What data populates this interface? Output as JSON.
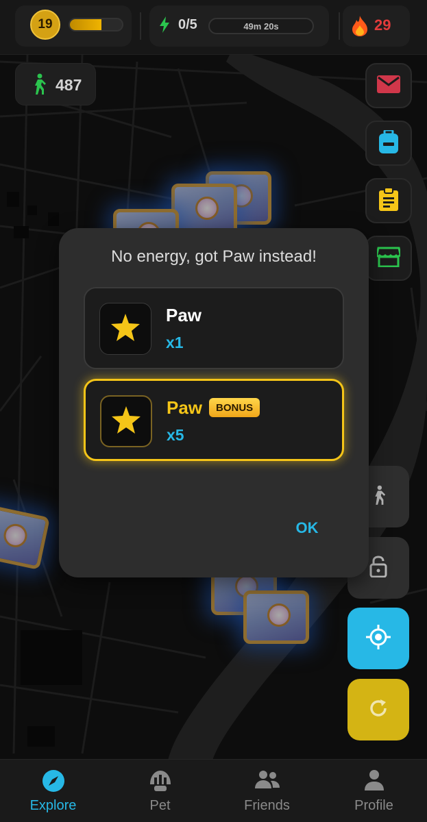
{
  "hud": {
    "level": "19",
    "xp_progress": 0.6,
    "energy": "0/5",
    "energy_timer": "49m 20s",
    "streak": "29",
    "steps": "487"
  },
  "side_buttons": [
    {
      "name": "mail-icon",
      "color": "#d0374a"
    },
    {
      "name": "backpack-icon",
      "color": "#27b8e6"
    },
    {
      "name": "clipboard-icon",
      "color": "#f5c518"
    },
    {
      "name": "store-icon",
      "color": "#2bc44e"
    }
  ],
  "dialog": {
    "title": "No energy, got Paw instead!",
    "rewards": [
      {
        "name": "Paw",
        "qty": "x1",
        "icon": "star-icon"
      },
      {
        "name": "Paw",
        "qty": "x5",
        "tag": "BONUS",
        "icon": "star-icon"
      }
    ],
    "ok_label": "OK"
  },
  "controls": [
    {
      "name": "walk-mode-button",
      "color": "#2e2e2e"
    },
    {
      "name": "lock-button",
      "color": "#2e2e2e"
    },
    {
      "name": "locate-button",
      "color": "#27b8e6"
    },
    {
      "name": "refresh-button",
      "color": "#d4b414"
    }
  ],
  "nav": {
    "items": [
      {
        "label": "Explore",
        "icon": "compass-icon",
        "active": true
      },
      {
        "label": "Pet",
        "icon": "pet-icon"
      },
      {
        "label": "Friends",
        "icon": "friends-icon"
      },
      {
        "label": "Profile",
        "icon": "profile-icon"
      }
    ]
  },
  "colors": {
    "accent": "#27b8e6",
    "gold": "#f5c518",
    "energy": "#2bc44e",
    "streak": "#e23b3b"
  }
}
